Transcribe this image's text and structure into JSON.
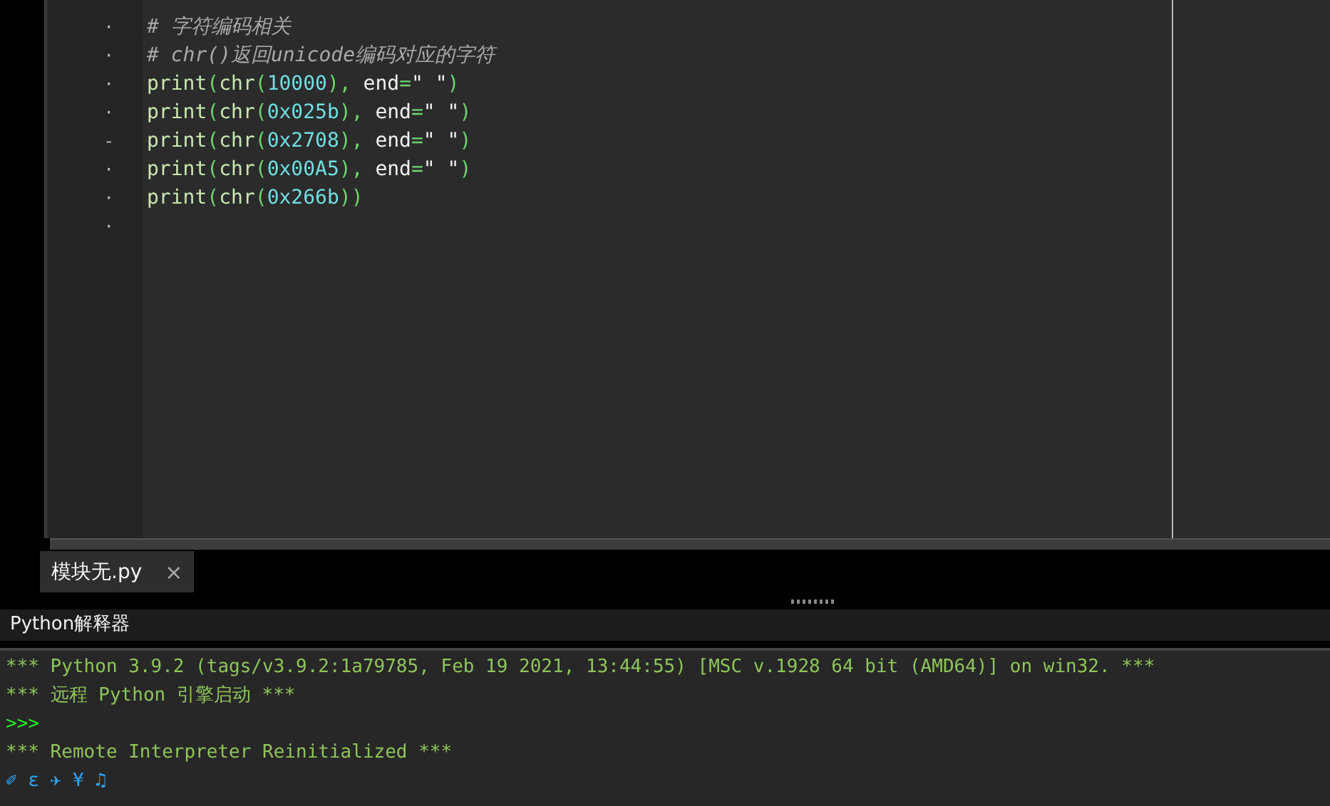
{
  "editor": {
    "lines": [
      {
        "marker": "·",
        "tokens": [
          {
            "kind": "comment",
            "text": "# 字符编码相关"
          }
        ]
      },
      {
        "marker": "·",
        "tokens": [
          {
            "kind": "comment",
            "text": "# chr()返回unicode编码对应的字符"
          }
        ]
      },
      {
        "marker": "·",
        "tokens": [
          {
            "kind": "builtin",
            "text": "print"
          },
          {
            "kind": "punct",
            "text": "("
          },
          {
            "kind": "builtin",
            "text": "chr"
          },
          {
            "kind": "punct",
            "text": "("
          },
          {
            "kind": "number",
            "text": "10000"
          },
          {
            "kind": "punct",
            "text": "),"
          },
          {
            "kind": "plain",
            "text": " end"
          },
          {
            "kind": "punct",
            "text": "="
          },
          {
            "kind": "plain",
            "text": "\" \""
          },
          {
            "kind": "punct",
            "text": ")"
          }
        ]
      },
      {
        "marker": "·",
        "tokens": [
          {
            "kind": "builtin",
            "text": "print"
          },
          {
            "kind": "punct",
            "text": "("
          },
          {
            "kind": "builtin",
            "text": "chr"
          },
          {
            "kind": "punct",
            "text": "("
          },
          {
            "kind": "number",
            "text": "0x025b"
          },
          {
            "kind": "punct",
            "text": "),"
          },
          {
            "kind": "plain",
            "text": " end"
          },
          {
            "kind": "punct",
            "text": "="
          },
          {
            "kind": "plain",
            "text": "\" \""
          },
          {
            "kind": "punct",
            "text": ")"
          }
        ]
      },
      {
        "marker": "-",
        "tokens": [
          {
            "kind": "builtin",
            "text": "print"
          },
          {
            "kind": "punct",
            "text": "("
          },
          {
            "kind": "builtin",
            "text": "chr"
          },
          {
            "kind": "punct",
            "text": "("
          },
          {
            "kind": "number",
            "text": "0x2708"
          },
          {
            "kind": "punct",
            "text": "),"
          },
          {
            "kind": "plain",
            "text": " end"
          },
          {
            "kind": "punct",
            "text": "="
          },
          {
            "kind": "plain",
            "text": "\" \""
          },
          {
            "kind": "punct",
            "text": ")"
          }
        ]
      },
      {
        "marker": "·",
        "tokens": [
          {
            "kind": "builtin",
            "text": "print"
          },
          {
            "kind": "punct",
            "text": "("
          },
          {
            "kind": "builtin",
            "text": "chr"
          },
          {
            "kind": "punct",
            "text": "("
          },
          {
            "kind": "number",
            "text": "0x00A5"
          },
          {
            "kind": "punct",
            "text": "),"
          },
          {
            "kind": "plain",
            "text": " end"
          },
          {
            "kind": "punct",
            "text": "="
          },
          {
            "kind": "plain",
            "text": "\" \""
          },
          {
            "kind": "punct",
            "text": ")"
          }
        ]
      },
      {
        "marker": "·",
        "tokens": [
          {
            "kind": "builtin",
            "text": "print"
          },
          {
            "kind": "punct",
            "text": "("
          },
          {
            "kind": "builtin",
            "text": "chr"
          },
          {
            "kind": "punct",
            "text": "("
          },
          {
            "kind": "number",
            "text": "0x266b"
          },
          {
            "kind": "punct",
            "text": "))"
          }
        ]
      },
      {
        "marker": "·"
      }
    ]
  },
  "tabs": [
    {
      "label": "模块无.py",
      "close": "×",
      "selected": true
    }
  ],
  "shell": {
    "title": "Python解释器",
    "lines": [
      {
        "kind": "banner",
        "text": "*** Python 3.9.2 (tags/v3.9.2:1a79785, Feb 19 2021, 13:44:55) [MSC v.1928 64 bit (AMD64)] on win32. ***"
      },
      {
        "kind": "banner",
        "text": "*** 远程 Python 引擎启动 ***"
      },
      {
        "kind": "prompt",
        "text": ">>>"
      },
      {
        "kind": "banner",
        "text": "*** Remote Interpreter Reinitialized ***"
      },
      {
        "kind": "output",
        "text": "✐ ɛ ✈ ¥ ♫"
      }
    ]
  }
}
